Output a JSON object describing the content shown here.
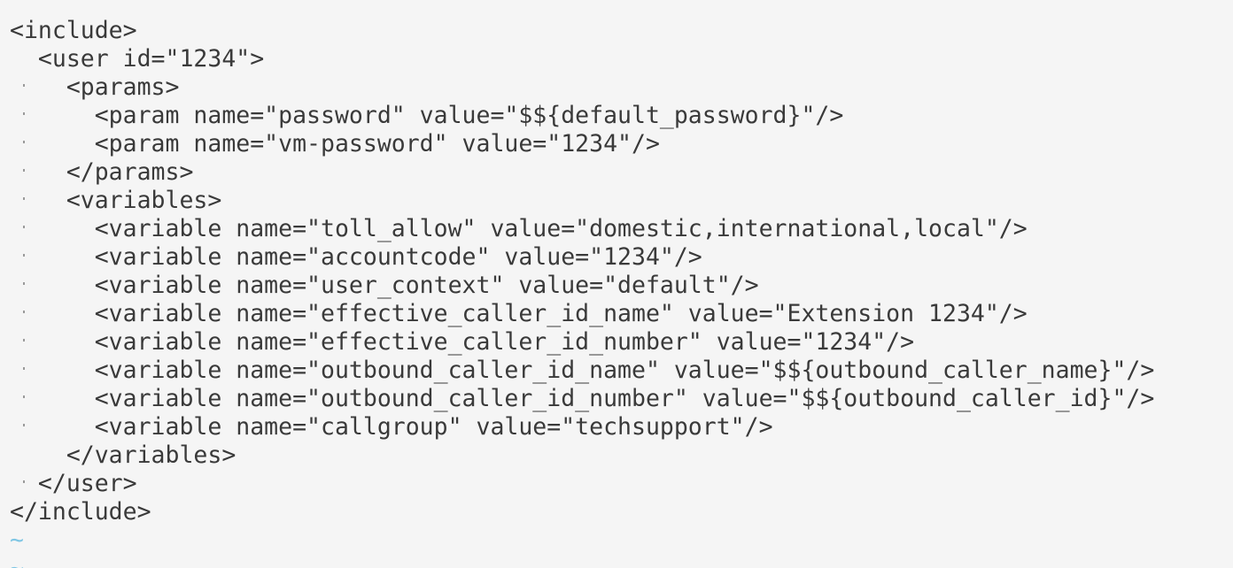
{
  "editor": {
    "lines": [
      {
        "text": "<include>"
      },
      {
        "text": "  <user id=\"1234\">"
      },
      {
        "text": "    <params>"
      },
      {
        "text": "      <param name=\"password\" value=\"$${default_password}\"/>"
      },
      {
        "text": "      <param name=\"vm-password\" value=\"1234\"/>"
      },
      {
        "text": "    </params>"
      },
      {
        "text": "    <variables>"
      },
      {
        "text": "      <variable name=\"toll_allow\" value=\"domestic,international,local\"/>"
      },
      {
        "text": "      <variable name=\"accountcode\" value=\"1234\"/>"
      },
      {
        "text": "      <variable name=\"user_context\" value=\"default\"/>"
      },
      {
        "text": "      <variable name=\"effective_caller_id_name\" value=\"Extension 1234\"/>"
      },
      {
        "text": "      <variable name=\"effective_caller_id_number\" value=\"1234\"/>"
      },
      {
        "text": "      <variable name=\"outbound_caller_id_name\" value=\"$${outbound_caller_name}\"/>"
      },
      {
        "text": "      <variable name=\"outbound_caller_id_number\" value=\"$${outbound_caller_id}\"/>"
      },
      {
        "text": "      <variable name=\"callgroup\" value=\"techsupport\"/>"
      },
      {
        "text": "    </variables>"
      },
      {
        "text": "  </user>"
      },
      {
        "text": "</include>"
      }
    ],
    "end_of_buffer_marker": "~",
    "colors": {
      "background": "#f5f5f5",
      "text": "#3a3a3a",
      "tilde": "#7fc6e4"
    }
  }
}
